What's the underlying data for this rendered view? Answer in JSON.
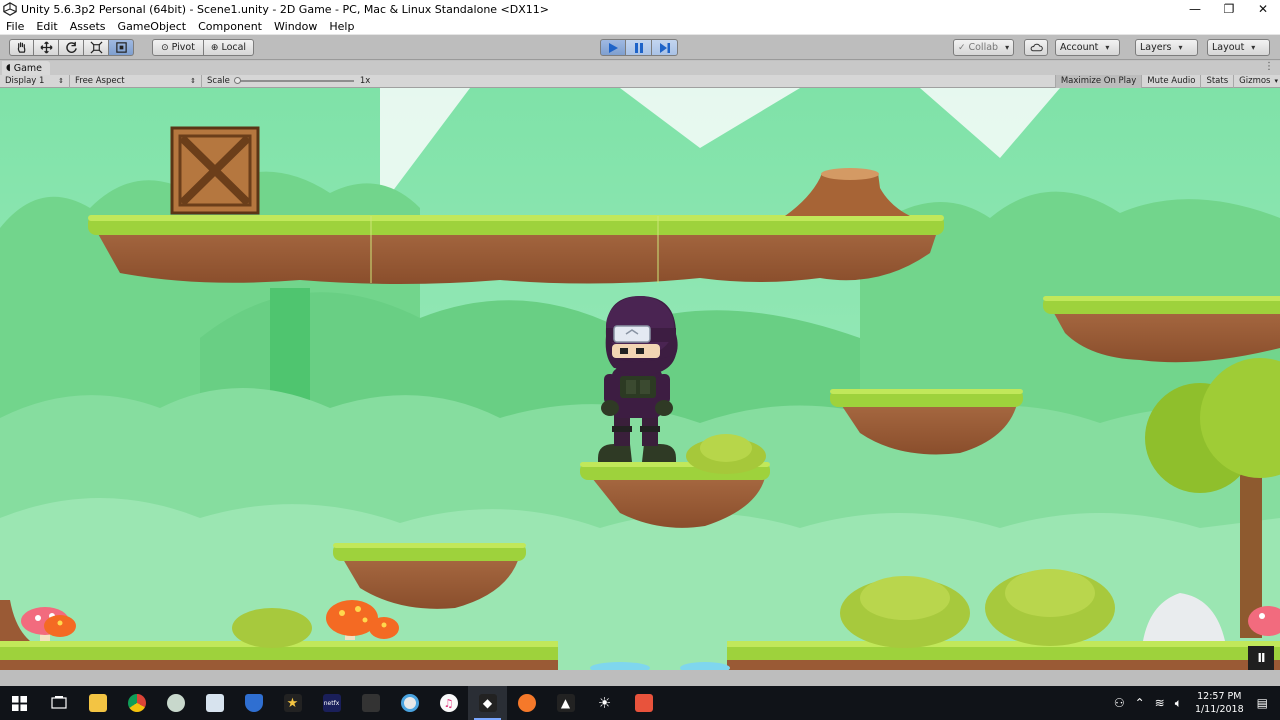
{
  "window": {
    "title": "Unity 5.6.3p2 Personal (64bit) - Scene1.unity - 2D Game - PC, Mac & Linux Standalone <DX11>",
    "controls": [
      "—",
      "❐",
      "✕"
    ]
  },
  "menu": [
    "File",
    "Edit",
    "Assets",
    "GameObject",
    "Component",
    "Window",
    "Help"
  ],
  "toolbar": {
    "tools": [
      "hand-tool",
      "move-tool",
      "rotate-tool",
      "scale-tool",
      "rect-tool"
    ],
    "pivot_label": "Pivot",
    "local_label": "Local",
    "play_state": "playing",
    "collab_label": "Collab",
    "account_label": "Account",
    "layers_label": "Layers",
    "layout_label": "Layout"
  },
  "game_tab": {
    "label": "Game"
  },
  "game_bar": {
    "display": "Display 1",
    "aspect": "Free Aspect",
    "scale_label": "Scale",
    "scale_value": "1x",
    "maximize_on_play": "Maximize On Play",
    "mute_audio": "Mute Audio",
    "stats": "Stats",
    "gizmos": "Gizmos"
  },
  "scene": {
    "sky_color": "#8fe4b5",
    "grass_color": "#9ed23c",
    "dirt_color": "#9a5a35",
    "player": "ninja character standing on floating island",
    "pause_overlay": "II"
  },
  "taskbar": {
    "apps": [
      "start",
      "task-view",
      "file-explorer",
      "chrome",
      "app-bird",
      "notepad",
      "defender",
      "star-app",
      "netflix",
      "app-gun",
      "app-vlc",
      "itunes",
      "unity",
      "blender",
      "app-ship",
      "app-sun",
      "sublime"
    ],
    "active_app": "unity",
    "time": "12:57 PM",
    "date": "1/11/2018"
  }
}
